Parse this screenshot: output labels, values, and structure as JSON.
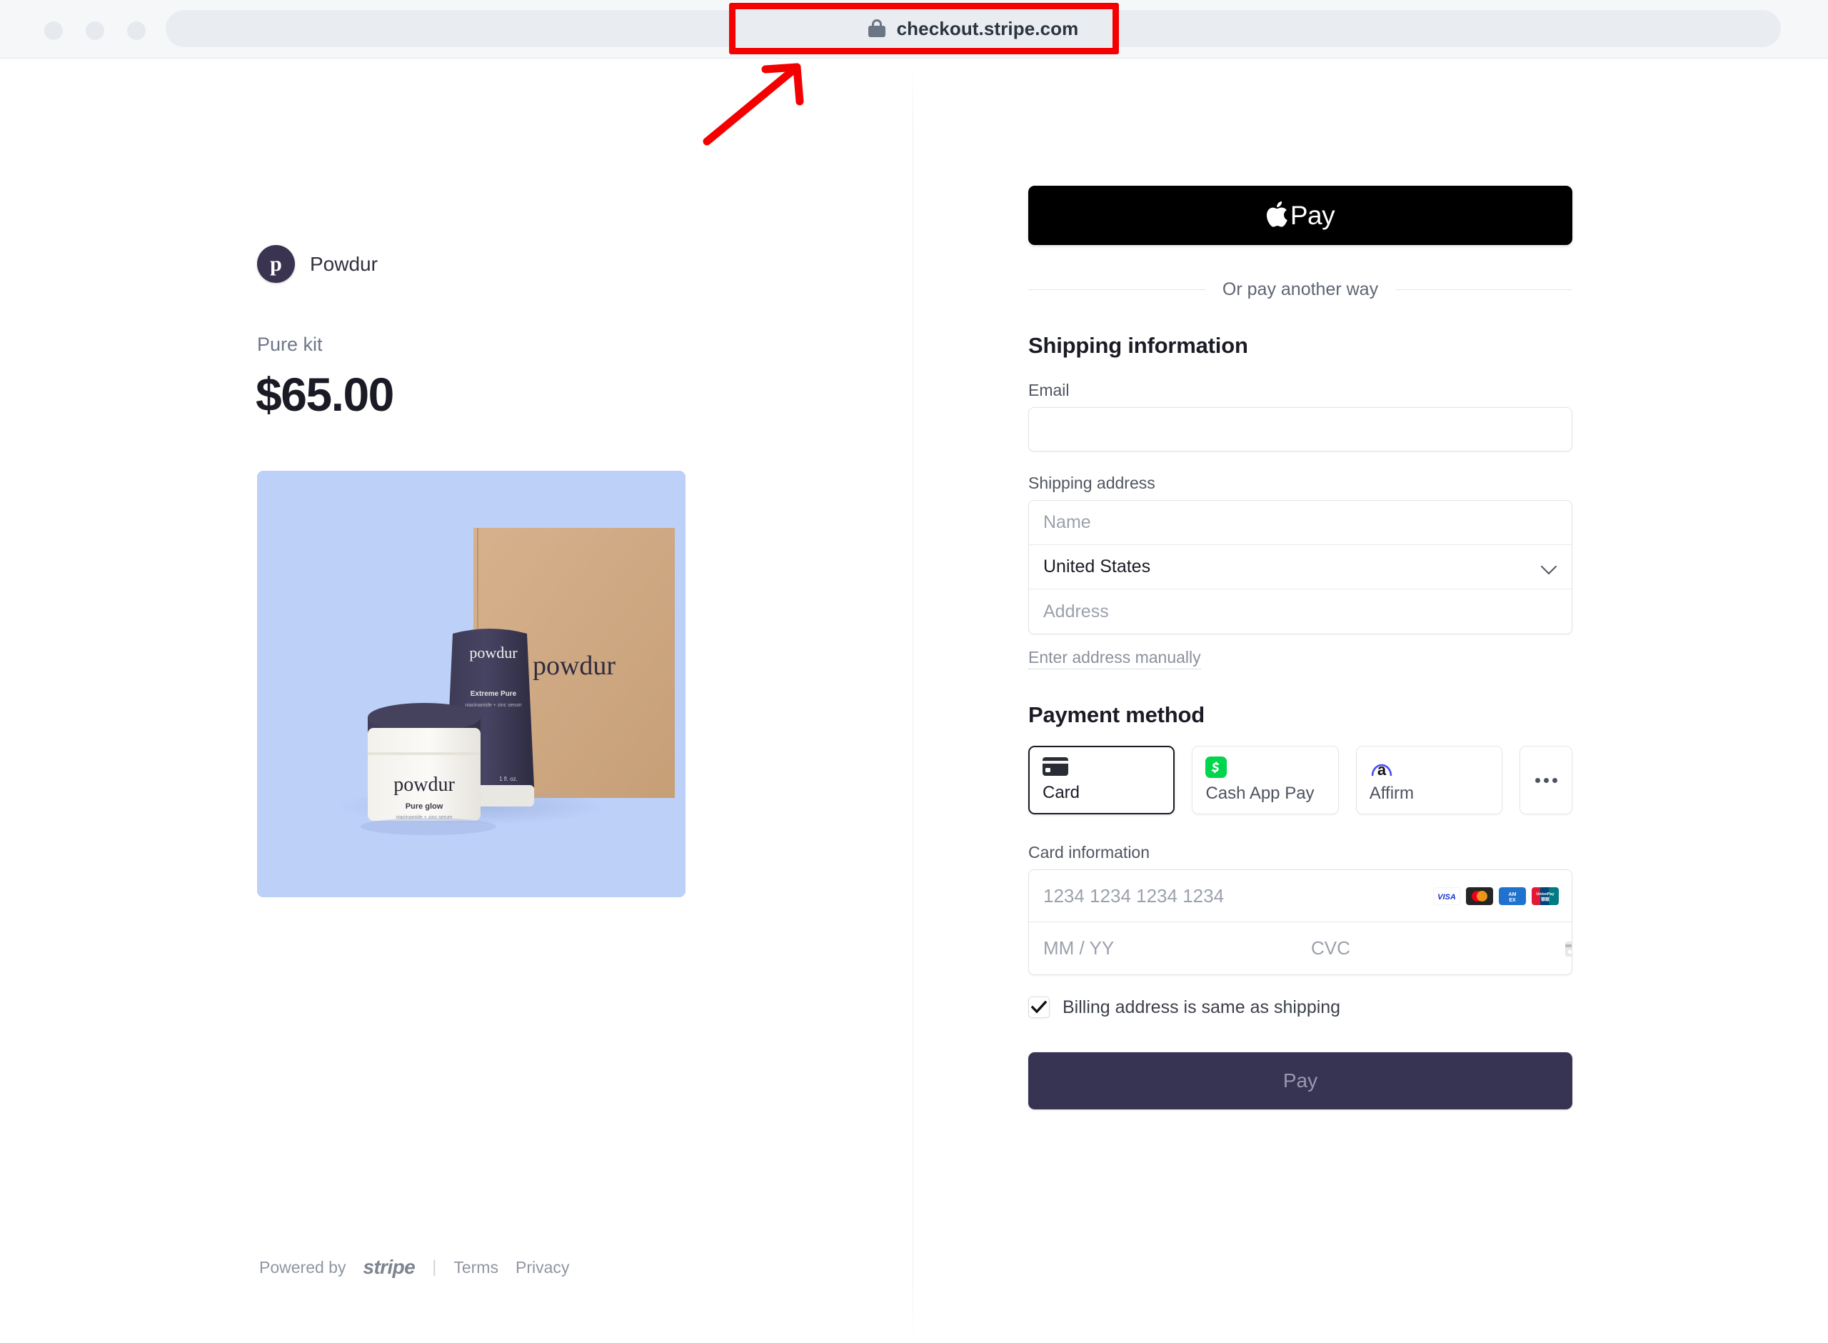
{
  "browser": {
    "url": "checkout.stripe.com",
    "lock_icon": "lock-icon",
    "traffic_lights": [
      "close",
      "minimize",
      "maximize"
    ]
  },
  "annotation": {
    "color": "#f40000",
    "target": "url-bar"
  },
  "summary": {
    "merchant_name": "Powdur",
    "merchant_initial": "p",
    "avatar_color": "#3b3450",
    "product_label": "Pure kit",
    "price": "$65.00",
    "image": {
      "background_color": "#bdd0f8",
      "box_brand": "powdur",
      "tube_brand": "powdur",
      "tube_product": "Extreme Pure",
      "tube_desc": "niacinamide + zinc serum",
      "tube_volume": "1 fl. oz.",
      "jar_brand": "powdur",
      "jar_product": "Pure glow",
      "jar_desc": "niacinamide + zinc serum"
    }
  },
  "footer": {
    "powered_by": "Powered by",
    "stripe_wordmark": "stripe",
    "separator": "|",
    "terms": "Terms",
    "privacy": "Privacy"
  },
  "checkout": {
    "apple_pay_label": "Pay",
    "apple_pay_icon": "apple-logo-icon",
    "divider_text": "Or pay another way",
    "shipping_title": "Shipping information",
    "email_label": "Email",
    "email_value": "",
    "email_placeholder": "",
    "address_label": "Shipping address",
    "name_placeholder": "Name",
    "country_value": "United States",
    "country_chevron": "chevron-down-icon",
    "address_placeholder": "Address",
    "manual_link": "Enter address manually",
    "payment_title": "Payment method",
    "payment_methods": [
      {
        "label": "Card",
        "icon": "credit-card-icon",
        "selected": true
      },
      {
        "label": "Cash App Pay",
        "icon": "cash-app-icon",
        "selected": false
      },
      {
        "label": "Affirm",
        "icon": "affirm-icon",
        "selected": false
      }
    ],
    "more_methods_icon": "ellipsis-icon",
    "card_info_label": "Card information",
    "card_number_placeholder": "1234 1234 1234 1234",
    "expiry_placeholder": "MM / YY",
    "cvc_placeholder": "CVC",
    "cvc_hint_icon": "cvc-card-icon",
    "card_brands": [
      "visa",
      "mastercard",
      "amex",
      "unionpay"
    ],
    "billing_checkbox_label": "Billing address is same as shipping",
    "billing_checked": true,
    "pay_button_label": "Pay",
    "pay_button_color": "#373453"
  }
}
